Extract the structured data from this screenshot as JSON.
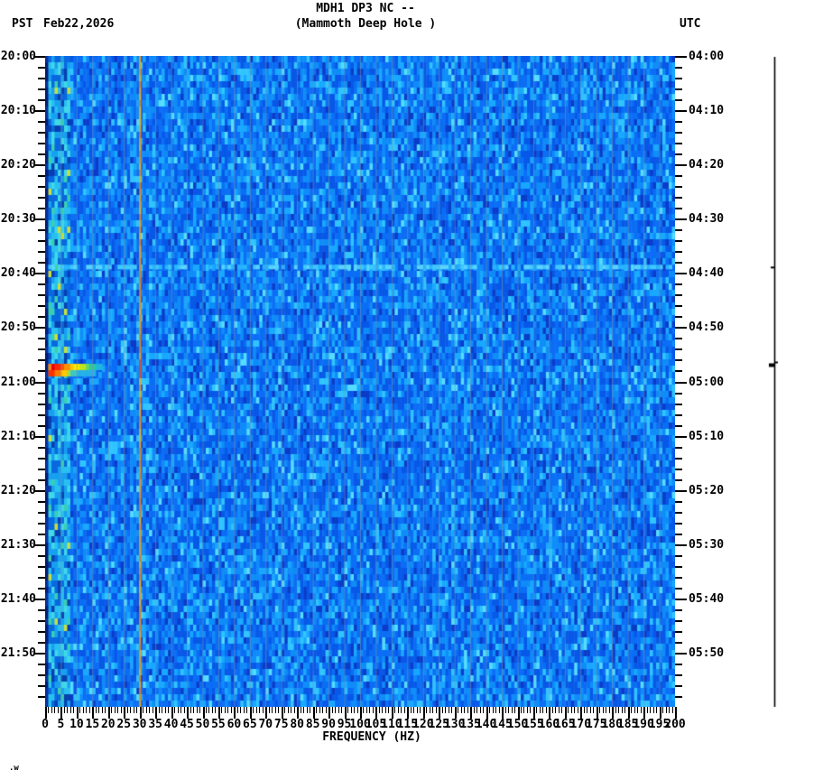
{
  "header": {
    "title": "MDH1 DP3 NC --",
    "subtitle": "(Mammoth Deep Hole )",
    "left_tz": "PST",
    "date": "Feb22,2026",
    "right_tz": "UTC"
  },
  "footer_note": ".w",
  "chart_data": {
    "type": "heatmap",
    "title": "MDH1 DP3 NC --",
    "subtitle": "(Mammoth Deep Hole )",
    "xlabel": "FREQUENCY (HZ)",
    "x_range_hz": [
      0,
      200
    ],
    "x_major_tick_step_hz": 5,
    "x_minor_tick_step_hz": 1,
    "x_tick_labels": [
      "0",
      "5",
      "10",
      "15",
      "20",
      "25",
      "30",
      "35",
      "40",
      "45",
      "50",
      "55",
      "60",
      "65",
      "70",
      "75",
      "80",
      "85",
      "90",
      "95",
      "100",
      "105",
      "110",
      "115",
      "120",
      "125",
      "130",
      "135",
      "140",
      "145",
      "150",
      "155",
      "160",
      "165",
      "170",
      "175",
      "180",
      "185",
      "190",
      "195",
      "200"
    ],
    "left_axis_tz": "PST",
    "right_axis_tz": "UTC",
    "left_time_ticks": [
      "20:00",
      "20:10",
      "20:20",
      "20:30",
      "20:40",
      "20:50",
      "21:00",
      "21:10",
      "21:20",
      "21:30",
      "21:40",
      "21:50"
    ],
    "right_time_ticks": [
      "04:00",
      "04:10",
      "04:20",
      "04:30",
      "04:40",
      "04:50",
      "05:00",
      "05:10",
      "05:20",
      "05:30",
      "05:40",
      "05:50"
    ],
    "time_span_minutes": 120,
    "major_time_tick_minutes": 10,
    "minor_time_tick_minutes": 2,
    "legend": "none",
    "grid": {
      "vertical_every_hz": 5,
      "color": "#7c94a6"
    },
    "background_palette": [
      "#0a3cc8",
      "#0858e8",
      "#0b6ef5",
      "#0f8cf8",
      "#18a8ff",
      "#30c4ff",
      "#55dcff"
    ],
    "low_freq_band_palette": [
      "#0640b0",
      "#0868e0",
      "#18a0f0",
      "#28c0f0",
      "#40d8e8",
      "#38d0b0",
      "#c8e040"
    ],
    "features": [
      {
        "kind": "vertical_line",
        "frequency_hz": 30,
        "colors": [
          "#ff9000",
          "#ffa800",
          "#ffc000",
          "#f07800"
        ],
        "description": "persistent narrowband signal at 30 Hz"
      },
      {
        "kind": "event_blob",
        "time_minutes_after_start": 57,
        "time_pst": "20:57",
        "frequency_range_hz": [
          1,
          18
        ],
        "peak_color": "#e80000",
        "ramp": [
          "#e80000",
          "#ff5000",
          "#ff9000",
          "#ffe000",
          "#a0e040",
          "#30c8a0",
          "#20b8d8"
        ],
        "description": "seismic event energy burst at low frequency"
      },
      {
        "kind": "horizontal_band",
        "time_minutes_after_start": 39,
        "time_pst": "20:39",
        "colors": [
          "#28b4ff",
          "#40c8ff",
          "#58d4ff"
        ],
        "description": "faint broadband horizontal band"
      },
      {
        "kind": "amplitude_trace",
        "position": "right-margin",
        "color": "#000000",
        "event_times_minutes": [
          39,
          57
        ],
        "description": "vertical amplitude trace with deflections at event times"
      }
    ]
  }
}
